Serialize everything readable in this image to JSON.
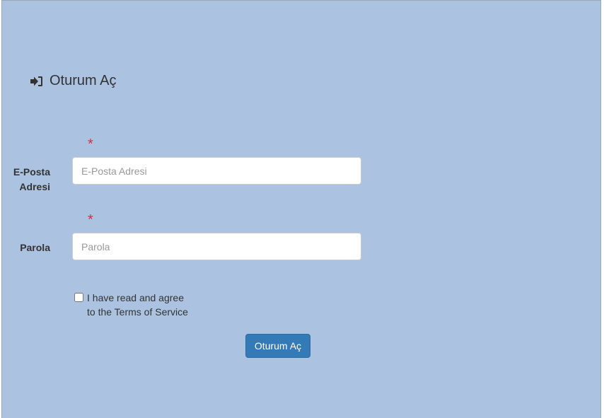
{
  "page": {
    "title": "Oturum Aç",
    "title_icon": "sign-in-icon"
  },
  "form": {
    "email": {
      "label_line1": "E-Posta",
      "label_line2": "Adresi",
      "required_mark": "*",
      "placeholder": "E-Posta Adresi",
      "value": ""
    },
    "password": {
      "label": "Parola",
      "required_mark": "*",
      "placeholder": "Parola",
      "value": ""
    },
    "terms": {
      "line1": "I have read and agree",
      "line2": "to the Terms of Service",
      "checked": false
    },
    "submit_label": "Oturum Aç"
  },
  "colors": {
    "background": "#abc2e1",
    "required": "#e0284a",
    "button": "#337ab7"
  }
}
